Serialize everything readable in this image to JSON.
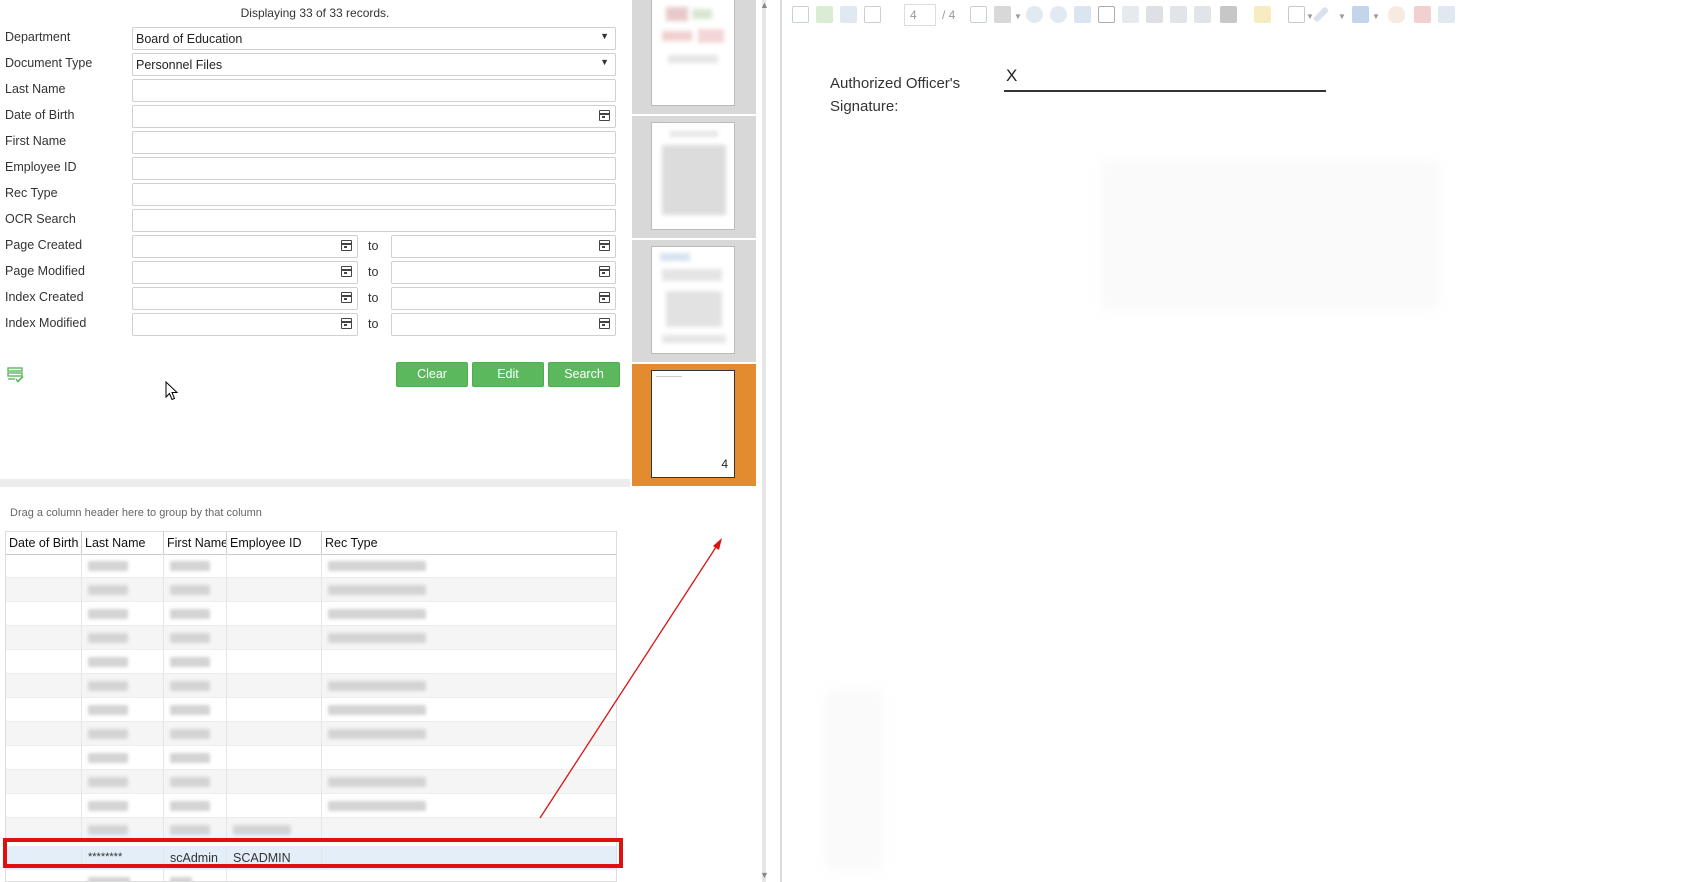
{
  "search": {
    "record_count": "Displaying 33 of 33 records.",
    "fields": [
      {
        "label": "Department",
        "value": "Board of Education"
      },
      {
        "label": "Document Type",
        "value": "Personnel Files"
      },
      {
        "label": "Last Name",
        "value": ""
      },
      {
        "label": "Date of Birth",
        "value": ""
      },
      {
        "label": "First Name",
        "value": ""
      },
      {
        "label": "Employee ID",
        "value": ""
      },
      {
        "label": "Rec Type",
        "value": ""
      },
      {
        "label": "OCR Search",
        "value": ""
      }
    ],
    "date_ranges": [
      {
        "label": "Page Created",
        "to": "to"
      },
      {
        "label": "Page Modified",
        "to": "to"
      },
      {
        "label": "Index Created",
        "to": "to"
      },
      {
        "label": "Index Modified",
        "to": "to"
      }
    ],
    "buttons": {
      "clear": "Clear",
      "edit": "Edit",
      "search": "Search"
    }
  },
  "grid": {
    "group_hint": "Drag a column header here to group by that column",
    "columns": [
      "Date of Birth",
      "Last Name",
      "First Name",
      "Employee ID",
      "Rec Type"
    ],
    "selected_row": {
      "date_of_birth": "",
      "last_name": "********",
      "first_name": "scAdmin",
      "employee_id": "SCADMIN",
      "rec_type": ""
    }
  },
  "thumbnails": {
    "active_page_number": "4"
  },
  "viewer": {
    "toolbar": {
      "page_input": "4",
      "page_total": "/ 4"
    },
    "signature_label": "Authorized Officer's Signature:",
    "signature_x": "X"
  },
  "colors": {
    "button_green": "#5cb85c",
    "thumb_active": "#e38b2f",
    "annotation_red": "#e01010"
  }
}
